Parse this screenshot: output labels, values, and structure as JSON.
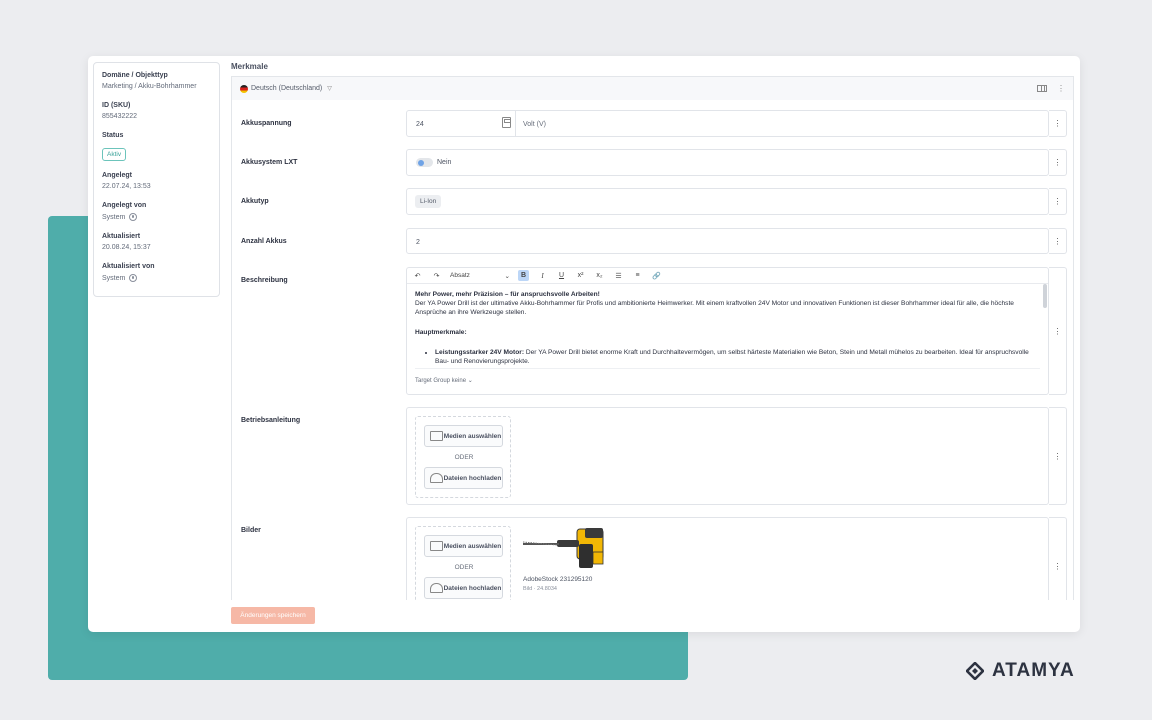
{
  "brand": {
    "name": "ATAMYA",
    "color": "#2d3341"
  },
  "meta": {
    "domain_label": "Domäne / Objekttyp",
    "domain_value": "Marketing / Akku-Bohrhammer",
    "id_label": "ID (SKU)",
    "id_value": "855432222",
    "status_label": "Status",
    "status_value": "Aktiv",
    "created_label": "Angelegt",
    "created_value": "22.07.24, 13:53",
    "created_by_label": "Angelegt von",
    "created_by_value": "System",
    "updated_label": "Aktualisiert",
    "updated_value": "20.08.24, 15:37",
    "updated_by_label": "Aktualisiert von",
    "updated_by_value": "System"
  },
  "section_title": "Merkmale",
  "language": {
    "selected": "Deutsch (Deutschland)"
  },
  "fields": {
    "battery_voltage": {
      "label": "Akkuspannung",
      "value": "24",
      "unit": "Volt (V)"
    },
    "battery_system": {
      "label": "Akkusystem LXT",
      "toggle_label": "Nein"
    },
    "battery_type": {
      "label": "Akkutyp",
      "tag": "Li-Ion"
    },
    "battery_count": {
      "label": "Anzahl Akkus",
      "value": "2"
    },
    "description": {
      "label": "Beschreibung",
      "format_select": "Absatz",
      "heading": "Mehr Power, mehr Präzision – für anspruchsvolle Arbeiten!",
      "paragraph": "Der YA Power Drill ist der ultimative Akku-Bohrhammer für Profis und ambitionierte Heimwerker. Mit einem kraftvollen 24V Motor und innovativen Funktionen ist dieser Bohrhammer ideal für alle, die höchste Ansprüche an ihre Werkzeuge stellen.",
      "subheading": "Hauptmerkmale:",
      "bullet_bold": "Leistungsstarker 24V Motor:",
      "bullet_text": " Der YA Power Drill bietet enorme Kraft und Durchhaltevermögen, um selbst härteste Materialien wie Beton, Stein und Metall mühelos zu bearbeiten. Ideal für anspruchsvolle Bau- und Renovierungsprojekte.",
      "target_group": "Target Group keine"
    },
    "manual": {
      "label": "Betriebsanleitung"
    },
    "images": {
      "label": "Bilder",
      "image_title": "AdobeStock 231295120",
      "image_meta": "Bild · 24.8034"
    }
  },
  "media": {
    "select_label": "Medien auswählen",
    "or_label": "ODER",
    "upload_label": "Dateien hochladen"
  },
  "save_label": "Änderungen speichern",
  "colors": {
    "teal": "#4fadaa",
    "save_disabled": "#f6b8a6",
    "status_badge": "#3aa39a",
    "toggle_knob": "#6fa3e6",
    "bold_active": "#bcd6f7"
  },
  "icons": [
    "flag-de-icon",
    "chevron-down-icon",
    "grid-view-icon",
    "kebab-icon",
    "calculator-icon",
    "gear-icon",
    "undo-icon",
    "redo-icon",
    "bold-icon",
    "italic-icon",
    "underline-icon",
    "superscript-icon",
    "subscript-icon",
    "bullet-list-icon",
    "numbered-list-icon",
    "link-icon",
    "media-library-icon",
    "upload-cloud-icon",
    "diamond-logo-icon"
  ]
}
